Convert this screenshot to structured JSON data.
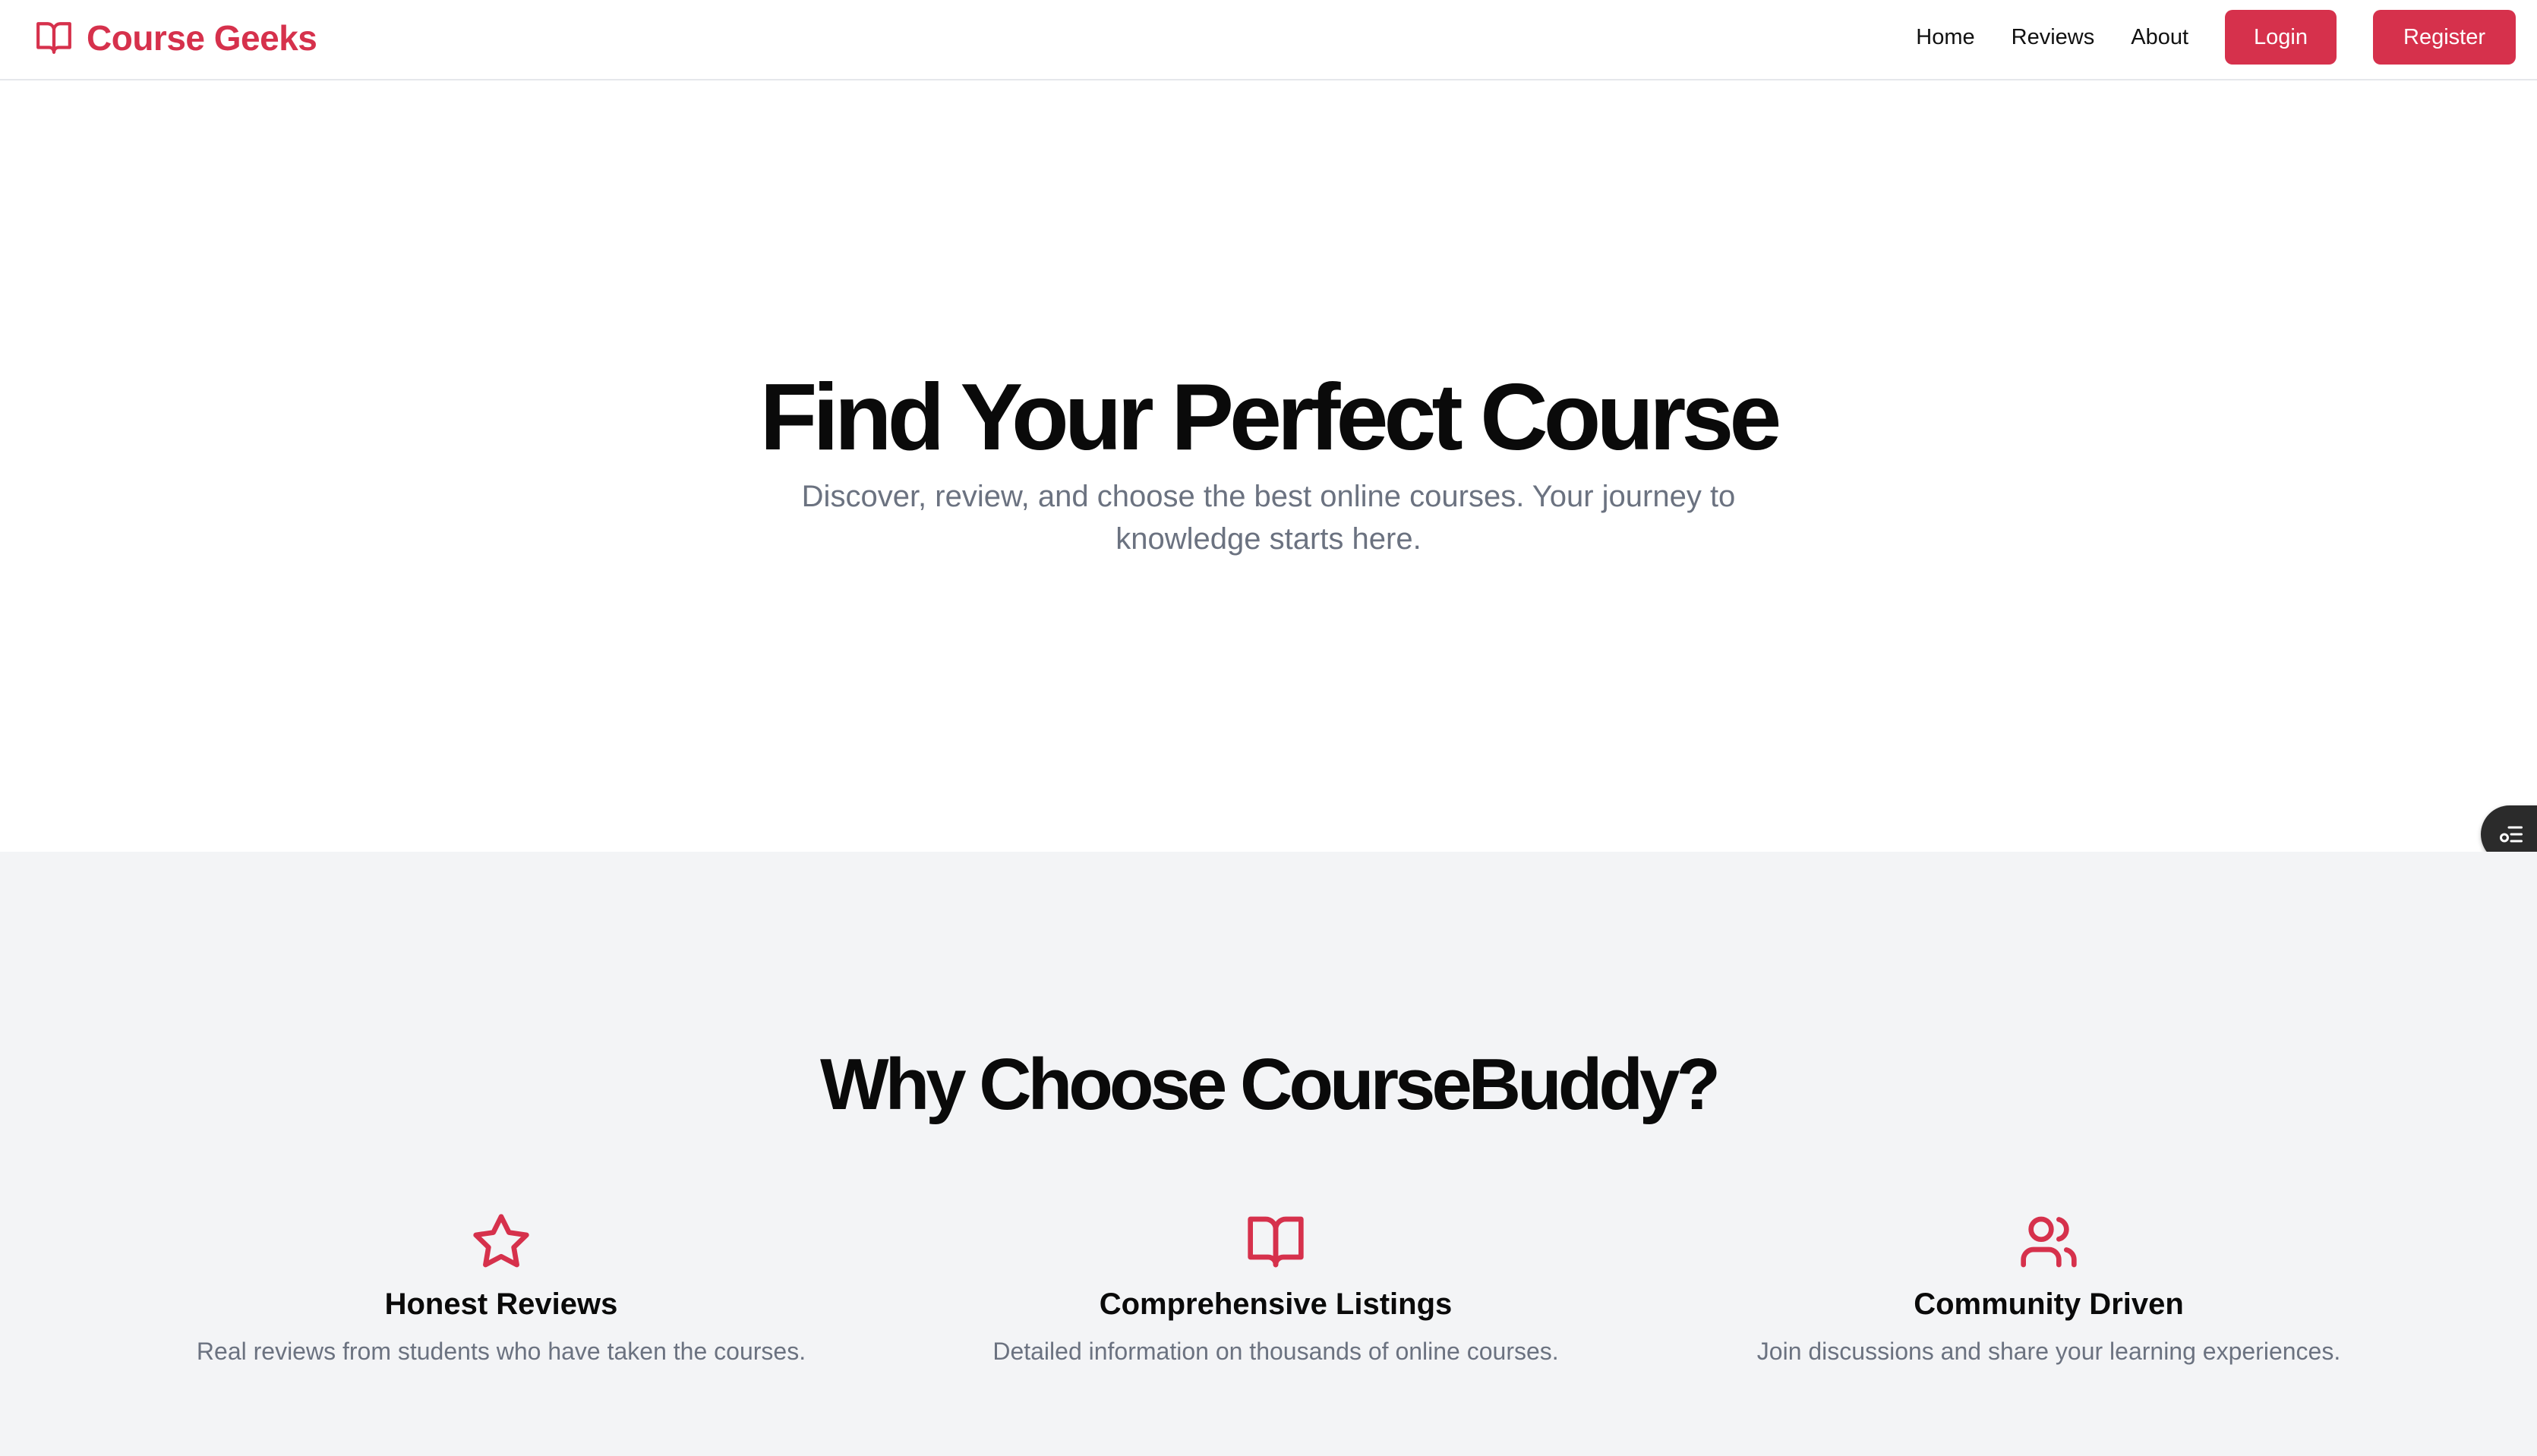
{
  "colors": {
    "brand": "#d6314c",
    "muted_text": "#6b7280",
    "features_bg": "#f3f4f6"
  },
  "header": {
    "brand": {
      "icon": "book-open-icon",
      "name": "Course Geeks"
    },
    "nav": [
      {
        "label": "Home"
      },
      {
        "label": "Reviews"
      },
      {
        "label": "About"
      }
    ],
    "login_label": "Login",
    "register_label": "Register"
  },
  "hero": {
    "title": "Find Your Perfect Course",
    "subtitle": "Discover, review, and choose the best online courses. Your journey to knowledge starts here."
  },
  "floating_button": {
    "icon": "list-settings-icon"
  },
  "features": {
    "title": "Why Choose CourseBuddy?",
    "items": [
      {
        "icon": "star-icon",
        "title": "Honest Reviews",
        "text": "Real reviews from students who have taken the courses."
      },
      {
        "icon": "book-open-icon",
        "title": "Comprehensive Listings",
        "text": "Detailed information on thousands of online courses."
      },
      {
        "icon": "users-icon",
        "title": "Community Driven",
        "text": "Join discussions and share your learning experiences."
      }
    ]
  }
}
